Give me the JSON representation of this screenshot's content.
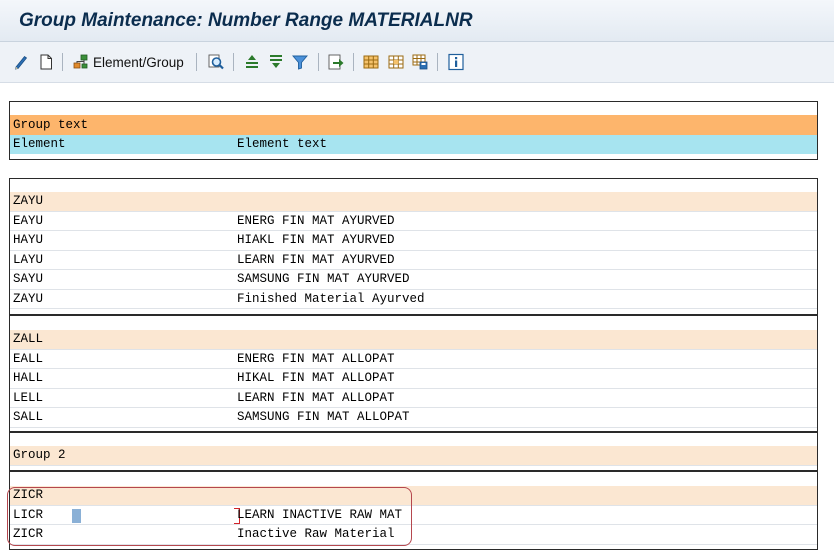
{
  "title": "Group Maintenance: Number Range MATERIALNR",
  "toolbar": {
    "element_group_label": "Element/Group"
  },
  "header": {
    "group_text_label": "Group text",
    "element_label": "Element",
    "element_text_label": "Element text"
  },
  "groups": [
    {
      "name": "ZAYU",
      "elements": [
        {
          "code": "EAYU",
          "text": "ENERG FIN MAT AYURVED"
        },
        {
          "code": "HAYU",
          "text": "HIAKL FIN MAT AYURVED"
        },
        {
          "code": "LAYU",
          "text": "LEARN FIN MAT AYURVED"
        },
        {
          "code": "SAYU",
          "text": "SAMSUNG FIN MAT AYURVED"
        },
        {
          "code": "ZAYU",
          "text": "Finished Material Ayurved"
        }
      ]
    },
    {
      "name": "ZALL",
      "elements": [
        {
          "code": "EALL",
          "text": "ENERG FIN MAT ALLOPAT"
        },
        {
          "code": "HALL",
          "text": "HIKAL FIN MAT ALLOPAT"
        },
        {
          "code": "LELL",
          "text": "LEARN FIN MAT ALLOPAT"
        },
        {
          "code": "SALL",
          "text": "SAMSUNG FIN MAT ALLOPAT"
        }
      ]
    },
    {
      "name": "Group 2",
      "elements": []
    },
    {
      "name": "ZICR",
      "elements": [
        {
          "code": "LICR",
          "text": "LEARN INACTIVE RAW MAT"
        },
        {
          "code": "ZICR",
          "text": "Inactive Raw Material"
        }
      ]
    }
  ],
  "colors": {
    "group_text_header": "#fdb56c",
    "element_header": "#a7e4f0",
    "group_row": "#fbe7d2",
    "highlight_border": "#b5474e"
  }
}
